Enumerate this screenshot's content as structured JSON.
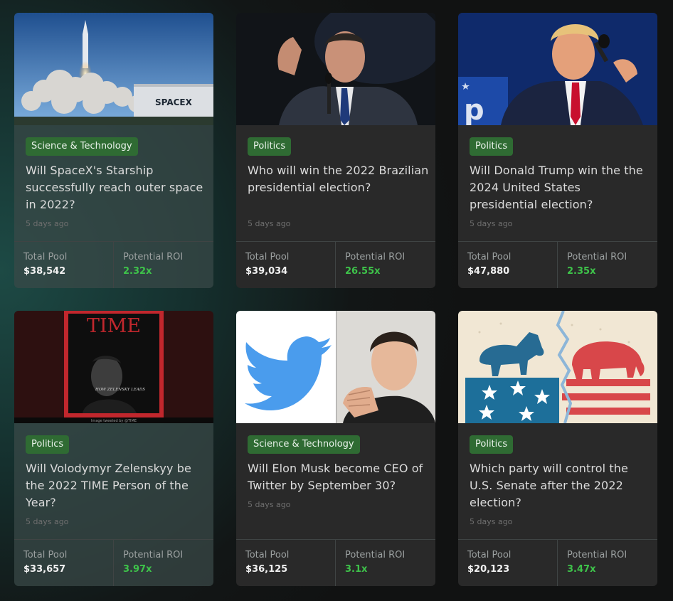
{
  "cards": [
    {
      "category": "Science & Technology",
      "title": "Will SpaceX's Starship successfully reach outer space in 2022?",
      "time": "5 days ago",
      "pool_label": "Total Pool",
      "pool": "$38,542",
      "roi_label": "Potential ROI",
      "roi": "2.32x",
      "image_text": "SPACEX"
    },
    {
      "category": "Politics",
      "title": "Who will win the 2022 Brazilian presidential election?",
      "time": "5 days ago",
      "pool_label": "Total Pool",
      "pool": "$39,034",
      "roi_label": "Potential ROI",
      "roi": "26.55x"
    },
    {
      "category": "Politics",
      "title": "Will Donald Trump win the the 2024 United States presidential election?",
      "time": "5 days ago",
      "pool_label": "Total Pool",
      "pool": "$47,880",
      "roi_label": "Potential ROI",
      "roi": "2.35x"
    },
    {
      "category": "Politics",
      "title": "Will Volodymyr Zelenskyy be the 2022 TIME Person of the Year?",
      "time": "5 days ago",
      "pool_label": "Total Pool",
      "pool": "$33,657",
      "roi_label": "Potential ROI",
      "roi": "3.97x",
      "image_text": "TIME",
      "image_sub": "HOW ZELENSKY LEADS",
      "image_credit": "Image tweeted by @TIME"
    },
    {
      "category": "Science & Technology",
      "title": "Will Elon Musk become CEO of Twitter by September 30?",
      "time": "5 days ago",
      "pool_label": "Total Pool",
      "pool": "$36,125",
      "roi_label": "Potential ROI",
      "roi": "3.1x"
    },
    {
      "category": "Politics",
      "title": "Which party will control the U.S. Senate after the 2022 election?",
      "time": "5 days ago",
      "pool_label": "Total Pool",
      "pool": "$20,123",
      "roi_label": "Potential ROI",
      "roi": "3.47x"
    }
  ],
  "colors": {
    "accent_green": "#3ec34a",
    "badge_green": "#2f6b33",
    "card_bg": "#292929"
  },
  "icons": [
    "twitter-bird-icon"
  ]
}
